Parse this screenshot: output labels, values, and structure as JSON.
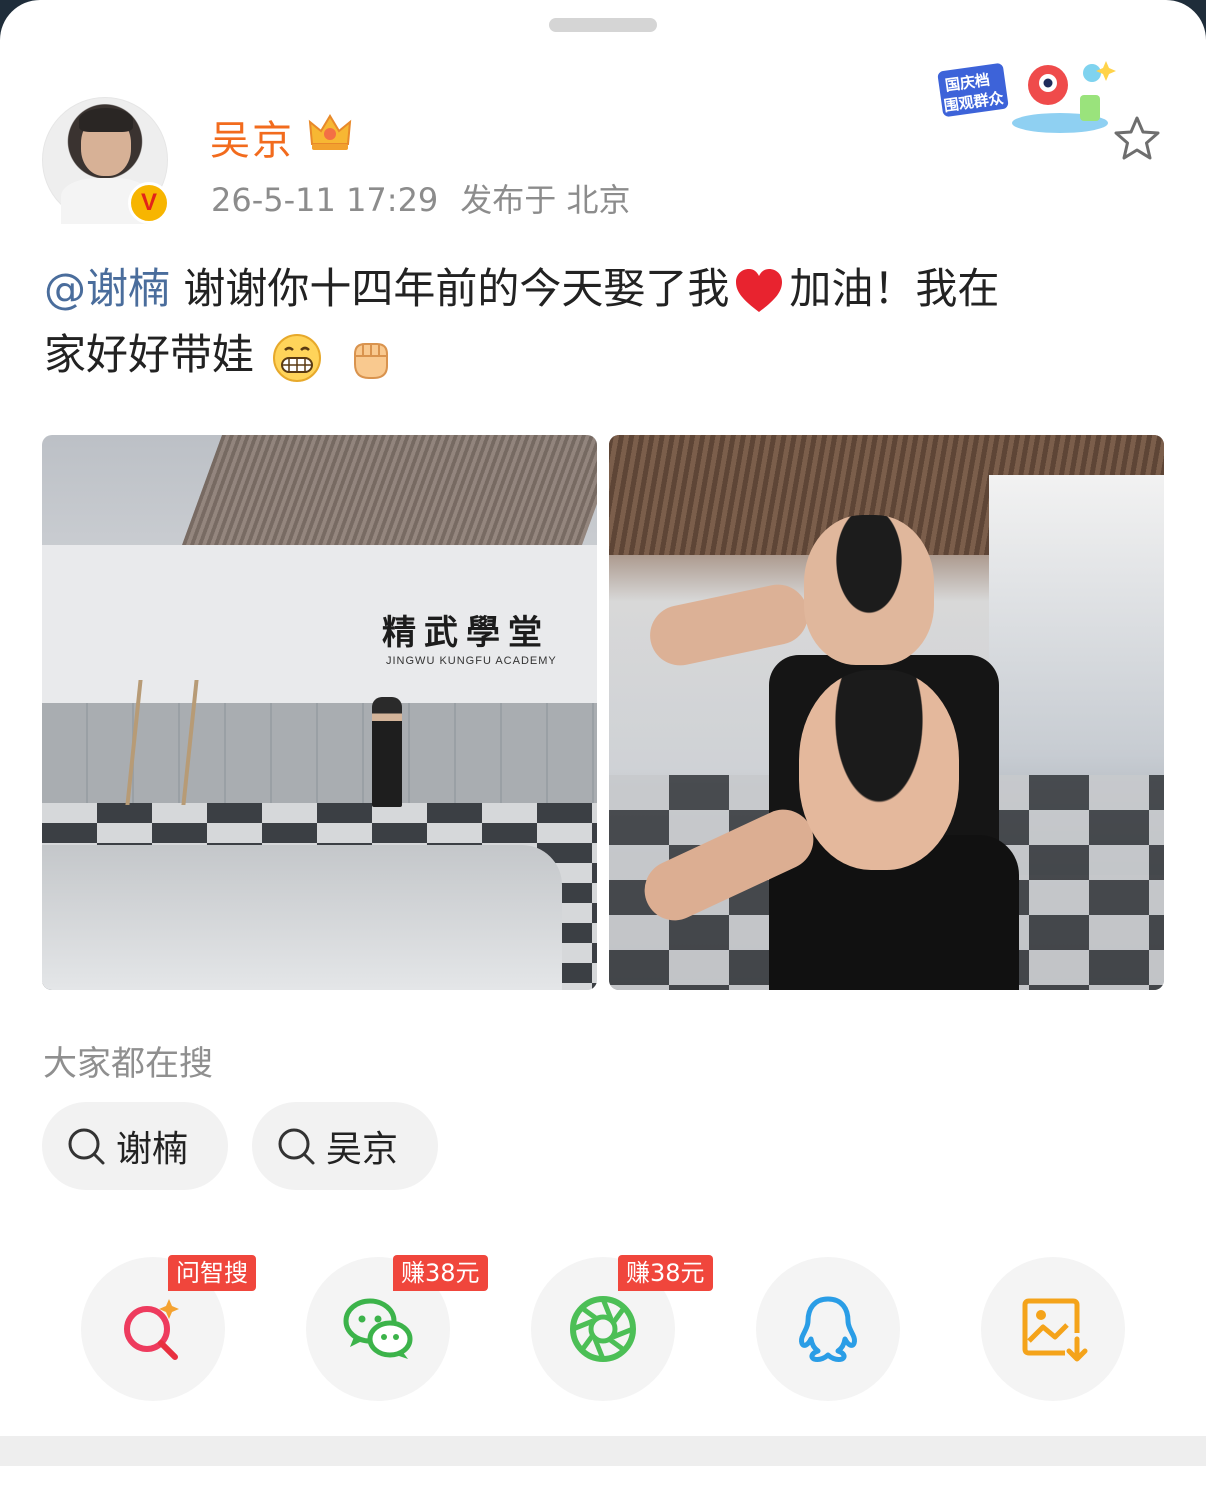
{
  "post": {
    "author": "吴京",
    "date": "26-5-11 17:29",
    "location": "发布于 北京",
    "mention": "@谢楠",
    "text_line1": " 谢谢你十四年前的今天娶了我",
    "text_after_heart": "加油！我在",
    "text_line2": "家好好带娃"
  },
  "images": {
    "sign_title": "精武學堂",
    "sign_subtitle": "JINGWU KUNGFU ACADEMY"
  },
  "promo": {
    "line1": "国庆档",
    "line2": "围观群众"
  },
  "search": {
    "label": "大家都在搜",
    "chips": [
      "谢楠",
      "吴京"
    ]
  },
  "share": {
    "items": [
      {
        "icon": "ai-search-icon",
        "tag": "问智搜"
      },
      {
        "icon": "wechat-icon",
        "tag": "赚38元"
      },
      {
        "icon": "moments-icon",
        "tag": "赚38元"
      },
      {
        "icon": "qq-icon",
        "tag": ""
      },
      {
        "icon": "save-image-icon",
        "tag": ""
      }
    ]
  },
  "colors": {
    "author": "#f26b1d",
    "mention": "#4a6d9c",
    "tag": "#f0463c",
    "wechat": "#3cb34a",
    "qq": "#2a9de6",
    "save": "#f4a31a"
  }
}
